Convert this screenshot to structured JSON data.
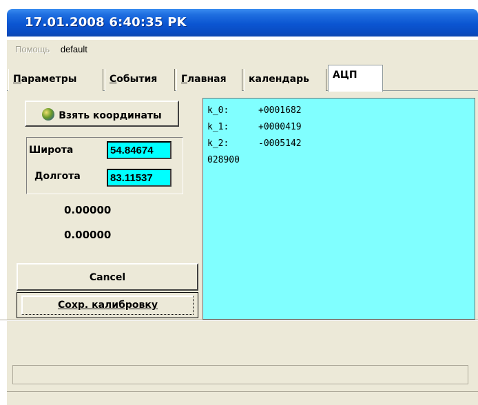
{
  "window": {
    "title": "17.01.2008 6:40:35 PK"
  },
  "menu": [
    {
      "label": "Помощь",
      "disabled": true
    },
    {
      "label": "default",
      "disabled": false
    }
  ],
  "tabs": [
    {
      "label": "Параметры",
      "accel": "П",
      "rest": "араметры"
    },
    {
      "label": "События",
      "accel": "С",
      "rest": "обытия"
    },
    {
      "label": "Главная",
      "accel": "Г",
      "rest": "лавная"
    },
    {
      "label": "календарь",
      "accel": "",
      "rest": "календарь"
    },
    {
      "label": "АЦП",
      "accel": "",
      "rest": "АЦП",
      "active": true
    }
  ],
  "adc": {
    "get_coords_button": "Взять координаты",
    "latitude_label": "Широта",
    "latitude_value": "54.84674",
    "longitude_label": "Долгота",
    "longitude_value": "83.11537",
    "value_1": "0.00000",
    "value_2": "0.00000",
    "cancel_button": "Cancel",
    "save_button": "Сохр. калибровку",
    "output": {
      "lines": [
        {
          "name": "k_0:",
          "value": "+0001682"
        },
        {
          "name": "k_1:",
          "value": "+0000419"
        },
        {
          "name": "k_2:",
          "value": "-0005142"
        }
      ],
      "last_line": "028900"
    }
  },
  "colors": {
    "accent": "#0a4cc2",
    "field": "#00ffff",
    "output_bg": "#80ffff"
  }
}
